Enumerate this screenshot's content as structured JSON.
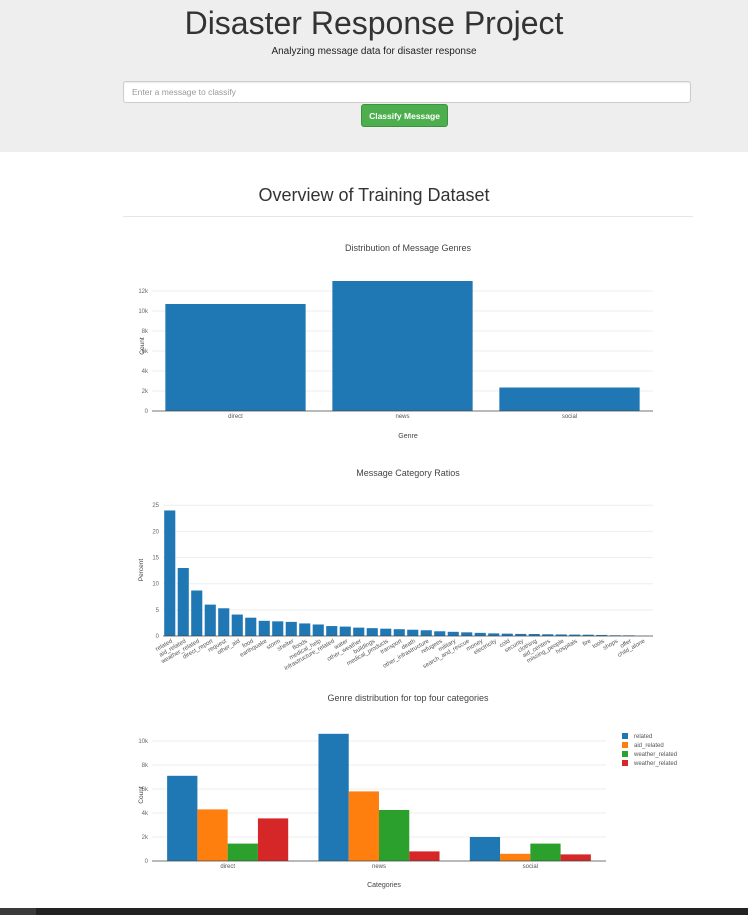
{
  "header": {
    "title": "Disaster Response Project",
    "subtitle": "Analyzing message data for disaster response",
    "input_placeholder": "Enter a message to classify",
    "button_label": "Classify Message"
  },
  "overview": {
    "title": "Overview of Training Dataset"
  },
  "chart_data": [
    {
      "type": "bar",
      "title": "Distribution of Message Genres",
      "xlabel": "Genre",
      "ylabel": "Count",
      "categories": [
        "direct",
        "news",
        "social"
      ],
      "values": [
        10700,
        13000,
        2350
      ],
      "ylim": [
        0,
        13000
      ],
      "yticks": [
        0,
        2000,
        4000,
        6000,
        8000,
        10000,
        12000
      ],
      "ytick_labels": [
        "0",
        "2k",
        "4k",
        "6k",
        "8k",
        "10k",
        "12k"
      ],
      "grid": true,
      "color": "#1f77b4"
    },
    {
      "type": "bar",
      "title": "Message Category Ratios",
      "xlabel": "",
      "ylabel": "Percent",
      "categories": [
        "related",
        "aid_related",
        "weather_related",
        "direct_report",
        "request",
        "other_aid",
        "food",
        "earthquake",
        "storm",
        "shelter",
        "floods",
        "medical_help",
        "infrastructure_related",
        "water",
        "other_weather",
        "buildings",
        "medical_products",
        "transport",
        "death",
        "other_infrastructure",
        "refugees",
        "military",
        "search_and_rescue",
        "money",
        "electricity",
        "cold",
        "security",
        "clothing",
        "aid_centers",
        "missing_people",
        "hospitals",
        "fire",
        "tools",
        "shops",
        "offer",
        "child_alone"
      ],
      "values": [
        24.0,
        13.0,
        8.7,
        6.0,
        5.3,
        4.1,
        3.5,
        2.9,
        2.8,
        2.7,
        2.4,
        2.2,
        1.9,
        1.8,
        1.6,
        1.5,
        1.4,
        1.3,
        1.2,
        1.1,
        0.9,
        0.8,
        0.7,
        0.6,
        0.5,
        0.45,
        0.4,
        0.38,
        0.33,
        0.3,
        0.27,
        0.25,
        0.2,
        0.13,
        0.12,
        0.0
      ],
      "ylim": [
        0,
        26
      ],
      "yticks": [
        0,
        5,
        10,
        15,
        20,
        25
      ],
      "ytick_labels": [
        "0",
        "5",
        "10",
        "15",
        "20",
        "25"
      ],
      "grid": true,
      "color": "#1f77b4"
    },
    {
      "type": "bar",
      "title": "Genre distribution for top four categories",
      "xlabel": "Categories",
      "ylabel": "Count",
      "categories": [
        "direct",
        "news",
        "social"
      ],
      "series": [
        {
          "name": "related",
          "values": [
            7100,
            10600,
            2000
          ],
          "color": "#1f77b4"
        },
        {
          "name": "aid_related",
          "values": [
            4300,
            5800,
            600
          ],
          "color": "#ff7f0e"
        },
        {
          "name": "weather_related",
          "values": [
            1450,
            4250,
            1450
          ],
          "color": "#2ca02c"
        },
        {
          "name": "weather_related",
          "values": [
            3550,
            800,
            550
          ],
          "color": "#d62728"
        }
      ],
      "ylim": [
        0,
        11000
      ],
      "yticks": [
        0,
        2000,
        4000,
        6000,
        8000,
        10000
      ],
      "ytick_labels": [
        "0",
        "2k",
        "4k",
        "6k",
        "8k",
        "10k"
      ],
      "grid": true,
      "legend": "top-right"
    }
  ]
}
